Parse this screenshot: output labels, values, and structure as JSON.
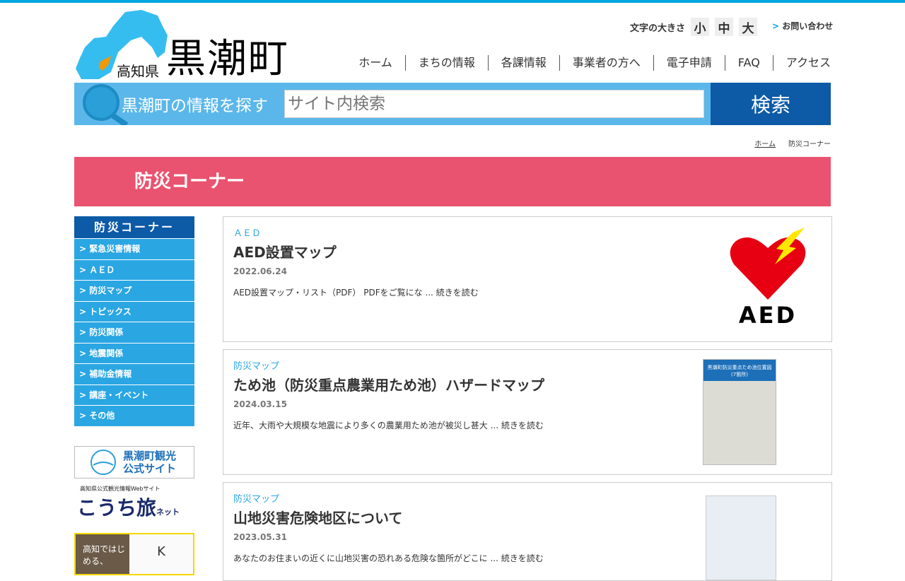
{
  "header": {
    "prefecture": "高知県",
    "town": "黒潮町",
    "font_size_label": "文字の大きさ",
    "font_sizes": [
      "小",
      "中",
      "大"
    ],
    "contact": "お問い合わせ"
  },
  "nav": [
    "ホーム",
    "まちの情報",
    "各課情報",
    "事業者の方へ",
    "電子申請",
    "FAQ",
    "アクセス"
  ],
  "search": {
    "label": "黒潮町の情報を探す",
    "placeholder": "サイト内検索",
    "button": "検索"
  },
  "breadcrumb": {
    "home": "ホーム",
    "current": "防災コーナー"
  },
  "page_title": "防災コーナー",
  "sidebar": {
    "title": "防災コーナー",
    "items": [
      "緊急災害情報",
      "ＡＥＤ",
      "防災マップ",
      "トピックス",
      "防災関係",
      "地震関係",
      "補助金情報",
      "講座・イベント",
      "その他"
    ]
  },
  "banners": {
    "kanko": "黒潮町観光\n公式サイト",
    "kanko_line1": "黒潮町観光",
    "kanko_line2": "公式サイト",
    "tabi_sub": "高知県公式観光情報Webサイト",
    "tabi_main": "こうち旅",
    "tabi_net": "ネット",
    "sogyo": "高知ではじめる、"
  },
  "articles": [
    {
      "category": "ＡＥＤ",
      "title": "AED設置マップ",
      "date": "2022.06.24",
      "excerpt": "AED設置マップ・リスト（PDF） PDFをご覧にな ... 続きを読む",
      "thumb_text": "AED"
    },
    {
      "category": "防災マップ",
      "title": "ため池（防災重点農業用ため池）ハザードマップ",
      "date": "2024.03.15",
      "excerpt": "近年、大雨や大規模な地震により多くの農業用ため池が被災し甚大 ... 続きを読む",
      "thumb_text": "黒潮町防災重点ため池位置図(7箇所)"
    },
    {
      "category": "防災マップ",
      "title": "山地災害危険地区について",
      "date": "2023.05.31",
      "excerpt": "あなたのお住まいの近くに山地災害の恐れある危険な箇所がどこに ... 続きを読む"
    }
  ],
  "colors": {
    "accent": "#00a7e1",
    "banner": "#e9536f",
    "navy": "#0d5aa7",
    "side": "#2aa6e3"
  }
}
